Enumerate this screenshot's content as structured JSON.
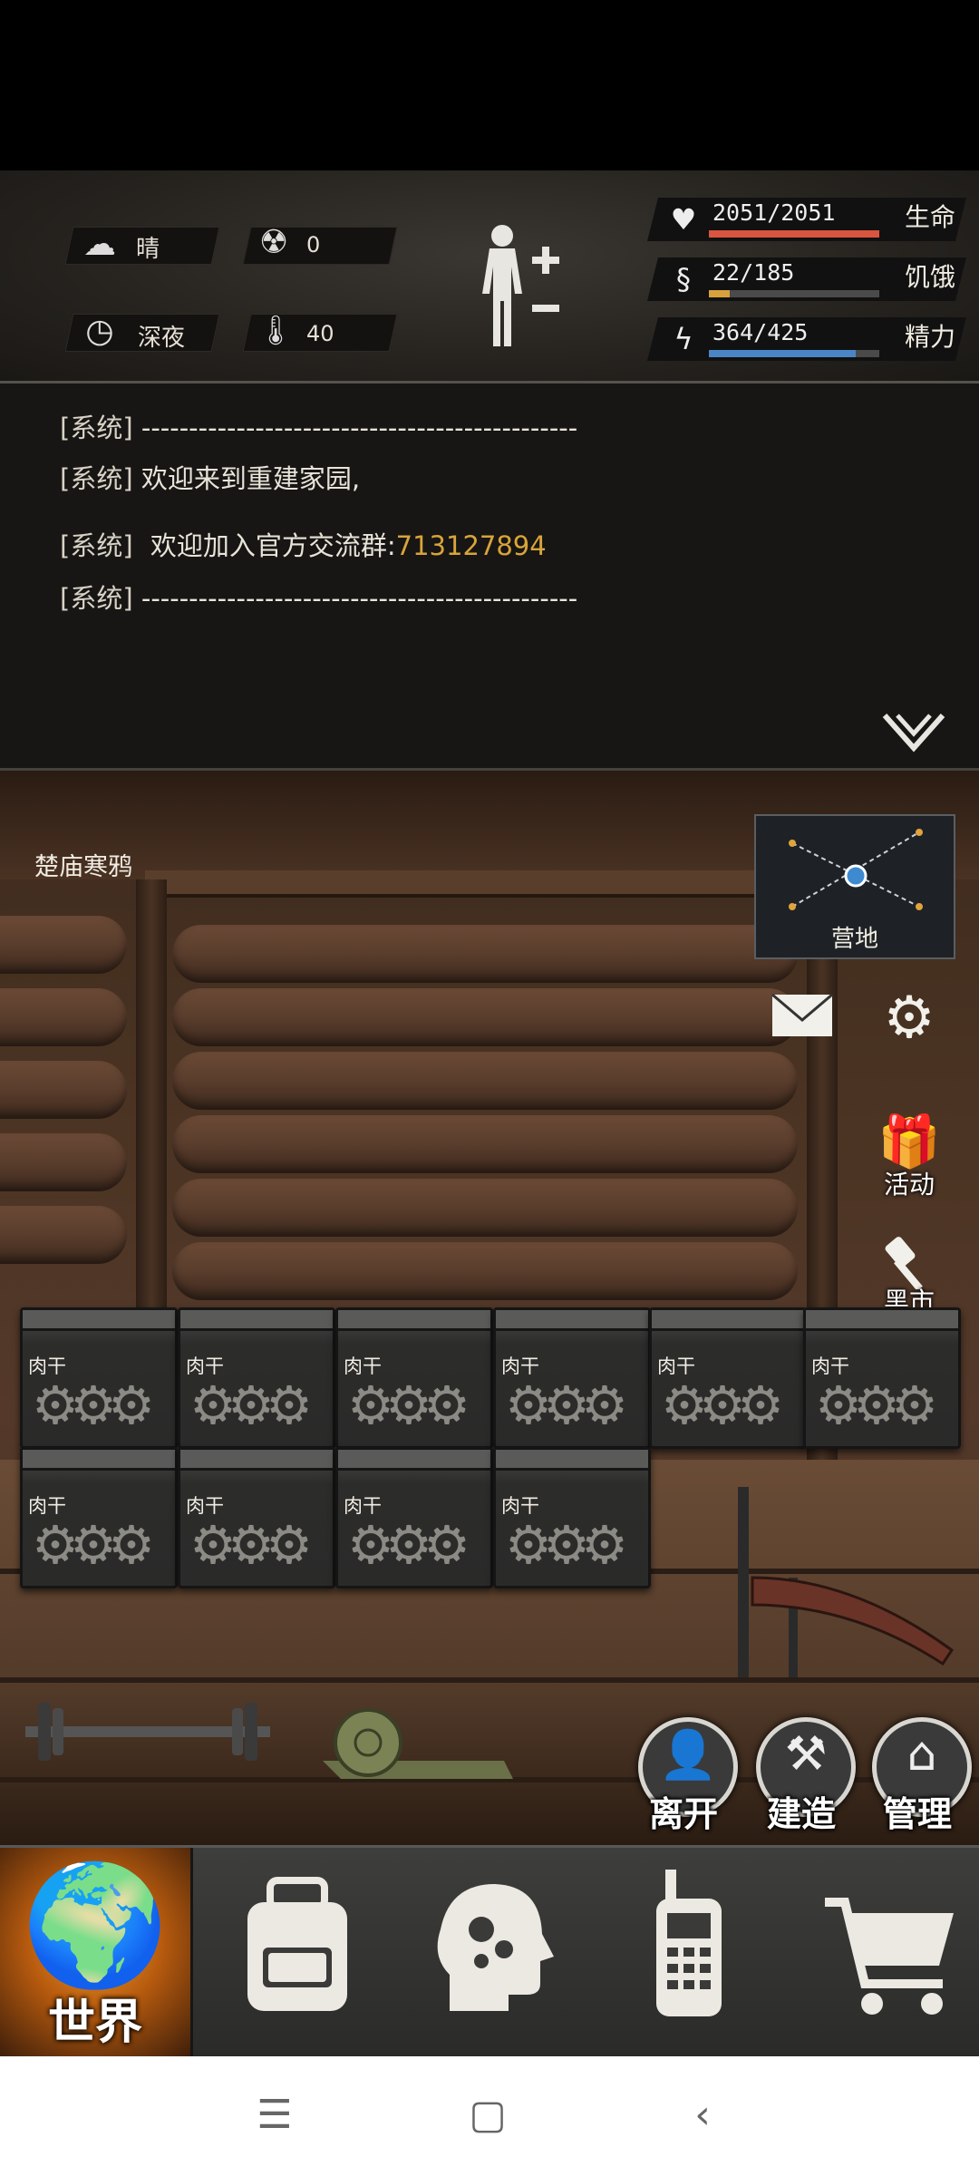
{
  "environment": {
    "weather": "晴",
    "radiation": "0",
    "time_of_day": "深夜",
    "temperature": "40"
  },
  "stats": [
    {
      "id": "health",
      "value": "2051/2051",
      "name": "生命",
      "fill": 1.0,
      "color": "#d9553f",
      "icon": "heart-pulse-icon"
    },
    {
      "id": "hunger",
      "value": "22/185",
      "name": "饥饿",
      "fill": 0.12,
      "color": "#d8a13c",
      "icon": "stomach-icon"
    },
    {
      "id": "energy",
      "value": "364/425",
      "name": "精力",
      "fill": 0.86,
      "color": "#4a86c5",
      "icon": "energy-icon"
    }
  ],
  "log": {
    "tag": "[系统]",
    "divider": "----------------------------------------------",
    "welcome": "欢迎来到重建家园,",
    "join_text": "欢迎加入官方交流群:",
    "join_number": "713127894"
  },
  "scene": {
    "player_name": "楚庙寒鸦",
    "map_label": "营地",
    "side_buttons": {
      "activity": "活动",
      "black_market": "黑市"
    },
    "crates": [
      "肉干",
      "肉干",
      "肉干",
      "肉干",
      "肉干",
      "肉干",
      "肉干",
      "肉干",
      "肉干",
      "肉干"
    ],
    "actions": {
      "leave": "离开",
      "build": "建造",
      "manage": "管理"
    }
  },
  "nav": {
    "world": "世界",
    "icons": [
      "globe-icon",
      "backpack-icon",
      "skills-head-icon",
      "radio-icon",
      "shopping-cart-icon"
    ]
  }
}
